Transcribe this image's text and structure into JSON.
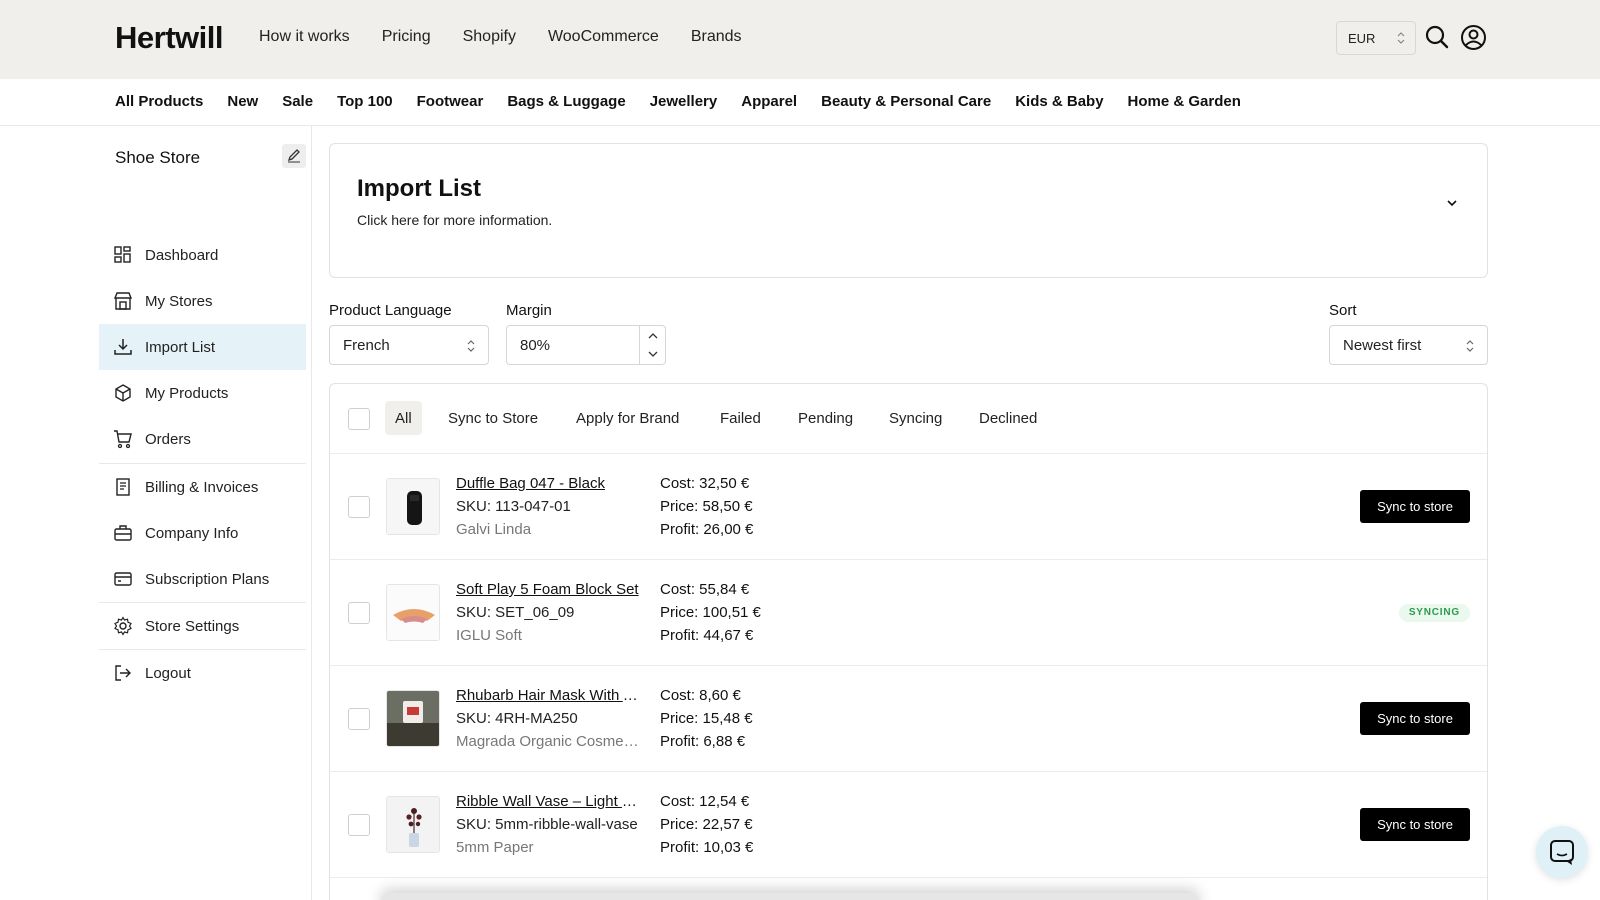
{
  "header": {
    "logo": "Hertwill",
    "nav": [
      "How it works",
      "Pricing",
      "Shopify",
      "WooCommerce",
      "Brands"
    ],
    "currency": "EUR"
  },
  "categories": [
    "All Products",
    "New",
    "Sale",
    "Top 100",
    "Footwear",
    "Bags & Luggage",
    "Jewellery",
    "Apparel",
    "Beauty & Personal Care",
    "Kids & Baby",
    "Home & Garden"
  ],
  "sidebar": {
    "store_name": "Shoe Store",
    "items": [
      {
        "label": "Dashboard",
        "icon": "dashboard-icon"
      },
      {
        "label": "My Stores",
        "icon": "store-icon"
      },
      {
        "label": "Import List",
        "icon": "download-icon",
        "active": true
      },
      {
        "label": "My Products",
        "icon": "box-icon"
      },
      {
        "label": "Orders",
        "icon": "cart-icon"
      },
      {
        "label": "Billing & Invoices",
        "icon": "receipt-icon"
      },
      {
        "label": "Company Info",
        "icon": "briefcase-icon"
      },
      {
        "label": "Subscription Plans",
        "icon": "credit-card-icon"
      },
      {
        "label": "Store Settings",
        "icon": "gear-icon"
      },
      {
        "label": "Logout",
        "icon": "logout-icon"
      }
    ]
  },
  "info": {
    "title": "Import List",
    "subtitle": "Click here for more information."
  },
  "controls": {
    "language_label": "Product Language",
    "language_value": "French",
    "margin_label": "Margin",
    "margin_value": "80%",
    "sort_label": "Sort",
    "sort_value": "Newest first"
  },
  "filters": [
    "All",
    "Sync to Store",
    "Apply for Brand",
    "Failed",
    "Pending",
    "Syncing",
    "Declined"
  ],
  "products": [
    {
      "name": "Duffle Bag 047 - Black",
      "sku": "SKU: 113-047-01",
      "brand": "Galvi Linda",
      "cost": "Cost: 32,50 €",
      "price": "Price: 58,50 €",
      "profit": "Profit: 26,00 €",
      "action": "Sync to store"
    },
    {
      "name": "Soft Play 5 Foam Block Set",
      "sku": "SKU: SET_06_09",
      "brand": "IGLU Soft",
      "cost": "Cost: 55,84 €",
      "price": "Price: 100,51 €",
      "profit": "Profit: 44,67 €",
      "status": "SYNCING"
    },
    {
      "name": "Rhubarb Hair Mask With Argan",
      "sku": "SKU: 4RH-MA250",
      "brand": "Magrada Organic Cosmetics",
      "cost": "Cost: 8,60 €",
      "price": "Price: 15,48 €",
      "profit": "Profit: 6,88 €",
      "action": "Sync to store"
    },
    {
      "name": "Ribble Wall Vase – Light Grey",
      "sku": "SKU: 5mm-ribble-wall-vase",
      "brand": "5mm Paper",
      "cost": "Cost: 12,54 €",
      "price": "Price: 22,57 €",
      "profit": "Profit: 10,03 €",
      "action": "Sync to store"
    }
  ]
}
